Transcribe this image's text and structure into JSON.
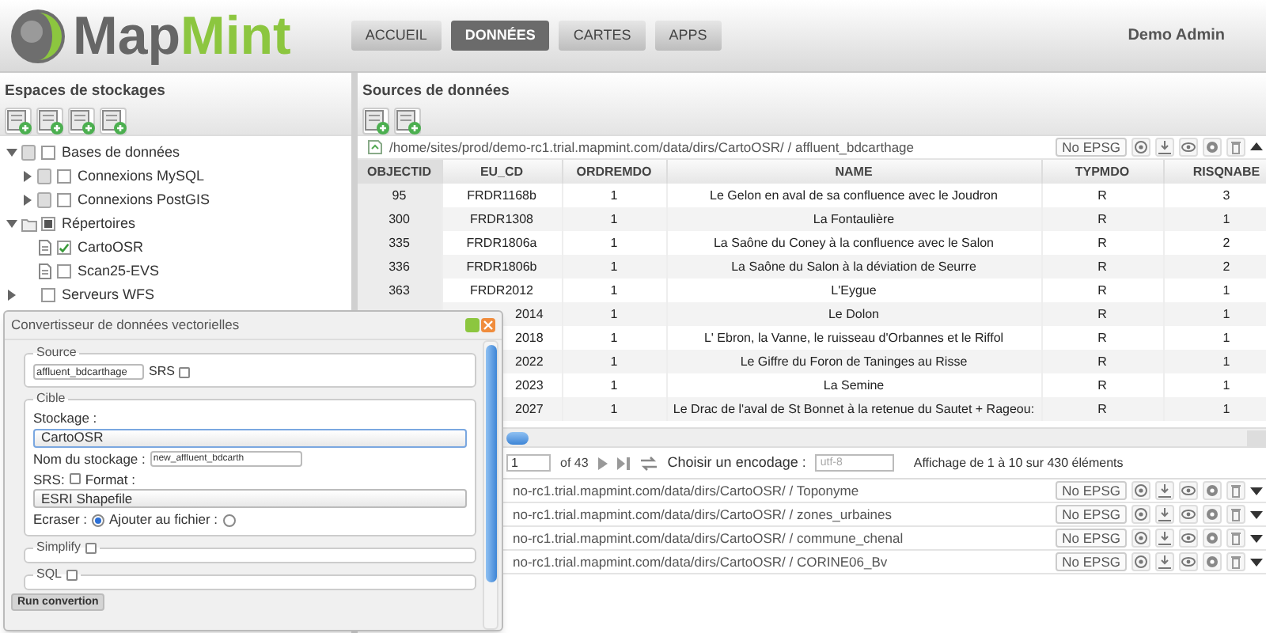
{
  "header": {
    "logo_part_1": "Map",
    "logo_part_2": "Mint",
    "nav": [
      {
        "label": "ACCUEIL",
        "selected": false
      },
      {
        "label": "DONNÉES",
        "selected": true
      },
      {
        "label": "CARTES",
        "selected": false
      },
      {
        "label": "APPS",
        "selected": false
      }
    ],
    "user": "Demo Admin"
  },
  "storage_panel": {
    "title": "Espaces de stockages",
    "tree": [
      {
        "label": "Bases de données",
        "kind": "database",
        "expanded": true,
        "checked": false,
        "indeterminate": false,
        "children": [
          {
            "label": "Connexions MySQL",
            "kind": "database",
            "expanded": false,
            "checked": false,
            "indeterminate": false
          },
          {
            "label": "Connexions PostGIS",
            "kind": "database",
            "expanded": false,
            "checked": false,
            "indeterminate": false
          }
        ]
      },
      {
        "label": "Répertoires",
        "kind": "folder",
        "expanded": true,
        "checked": false,
        "indeterminate": true,
        "children": [
          {
            "label": "CartoOSR",
            "kind": "file",
            "checked": true,
            "indeterminate": false
          },
          {
            "label": "Scan25-EVS",
            "kind": "file",
            "checked": false,
            "indeterminate": false
          }
        ]
      },
      {
        "label": "Serveurs WFS",
        "kind": "server",
        "expanded": false,
        "checked": false,
        "indeterminate": false
      }
    ]
  },
  "sources_panel": {
    "title": "Sources de données",
    "sources": [
      {
        "path": "/home/sites/prod/demo-rc1.trial.mapmint.com/data/dirs/CartoOSR/ / affluent_bdcarthage",
        "epsg": "No EPSG",
        "expanded": true,
        "table": {
          "columns": [
            "OBJECTID",
            "EU_CD",
            "ORDREMDO",
            "NAME",
            "TYPMDO",
            "RISQNABE"
          ],
          "rows": [
            [
              "95",
              "FRDR1168b",
              "1",
              "Le Gelon en aval de sa confluence avec le Joudron",
              "R",
              "3"
            ],
            [
              "300",
              "FRDR1308",
              "1",
              "La Fontaulière",
              "R",
              "1"
            ],
            [
              "335",
              "FRDR1806a",
              "1",
              "La Saône du Coney à la confluence avec le Salon",
              "R",
              "2"
            ],
            [
              "336",
              "FRDR1806b",
              "1",
              "La Saône du Salon à la déviation de Seurre",
              "R",
              "2"
            ],
            [
              "363",
              "FRDR2012",
              "1",
              "L'Eygue",
              "R",
              "1"
            ],
            [
              null,
              "2014",
              "1",
              "Le Dolon",
              "R",
              "1"
            ],
            [
              null,
              "2018",
              "1",
              "L' Ebron, la Vanne, le ruisseau d'Orbannes et le Riffol",
              "R",
              "1"
            ],
            [
              null,
              "2022",
              "1",
              "Le Giffre du Foron de Taninges au Risse",
              "R",
              "1"
            ],
            [
              null,
              "2023",
              "1",
              "La Semine",
              "R",
              "1"
            ],
            [
              null,
              "2027",
              "1",
              "Le Drac de l'aval de St Bonnet à la retenue du Sautet + Rageou:",
              "R",
              "1"
            ]
          ]
        },
        "pagination": {
          "page": "1",
          "of": "of 43",
          "encoding_label": "Choisir un encodage :",
          "encoding_placeholder": "utf-8",
          "status": "Affichage de 1 à 10 sur 430 éléments"
        }
      },
      {
        "path": "no-rc1.trial.mapmint.com/data/dirs/CartoOSR/ / Toponyme",
        "epsg": "No EPSG",
        "expanded": false
      },
      {
        "path": "no-rc1.trial.mapmint.com/data/dirs/CartoOSR/ / zones_urbaines",
        "epsg": "No EPSG",
        "expanded": false
      },
      {
        "path": "no-rc1.trial.mapmint.com/data/dirs/CartoOSR/ / commune_chenal",
        "epsg": "No EPSG",
        "expanded": false
      },
      {
        "path": "no-rc1.trial.mapmint.com/data/dirs/CartoOSR/ / CORINE06_Bv",
        "epsg": "No EPSG",
        "expanded": false
      }
    ]
  },
  "dialog": {
    "title": "Convertisseur de données vectorielles",
    "source": {
      "legend": "Source",
      "value": "affluent_bdcarthage",
      "srs_label": "SRS",
      "srs_checked": false
    },
    "target": {
      "legend": "Cible",
      "storage_label": "Stockage :",
      "storage": "CartoOSR",
      "name_label": "Nom du stockage :",
      "name_value": "new_affluent_bdcarth",
      "srs_label": "SRS:",
      "srs_checked": false,
      "format_label": "Format :",
      "format": "ESRI Shapefile",
      "overwrite_label": "Ecraser :",
      "overwrite_selected": true,
      "append_label": "Ajouter au fichier :",
      "append_selected": false
    },
    "simplify": {
      "legend": "Simplify",
      "checked": false
    },
    "sql": {
      "legend": "SQL",
      "checked": false
    },
    "button": "Run convertion"
  }
}
